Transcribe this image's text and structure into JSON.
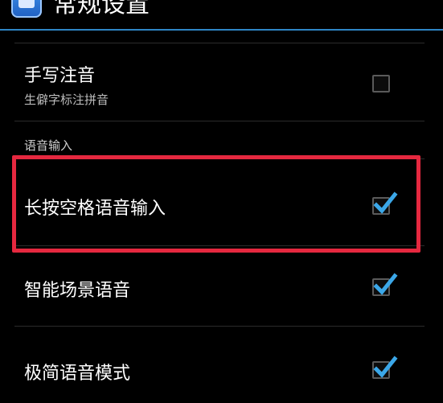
{
  "header": {
    "title": "常规设置",
    "icon": "app-keyboard-icon"
  },
  "settings": [
    {
      "title": "手写注音",
      "summary": "生僻字标注拼音",
      "checked": false
    }
  ],
  "section": {
    "header": "语音输入",
    "items": [
      {
        "title": "长按空格语音输入",
        "checked": true,
        "highlighted": true
      },
      {
        "title": "智能场景语音",
        "checked": true
      },
      {
        "title": "极简语音模式",
        "checked": true
      }
    ]
  },
  "colors": {
    "accent": "#2e86c6",
    "check": "#3ba7e8",
    "highlight_border": "#e5283f",
    "background": "#000000"
  }
}
